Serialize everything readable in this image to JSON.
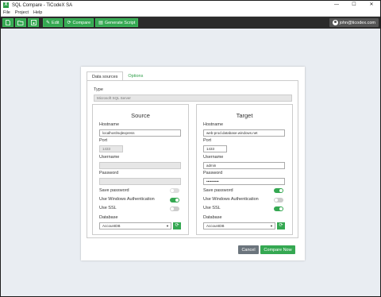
{
  "window": {
    "title": "SQL Compare - TiCodeX SA",
    "icon": "app-logo-icon",
    "controls": [
      "—",
      "☐",
      "✕"
    ]
  },
  "menu": {
    "items": [
      "File",
      "Project",
      "Help"
    ]
  },
  "toolbar": {
    "new_icon": "file-icon",
    "open_icon": "folder-open-icon",
    "save_icon": "save-icon",
    "edit_label": "Edit",
    "compare_label": "Compare",
    "generate_label": "Generate Script",
    "user_label": "john@ticodex.com"
  },
  "tabs": {
    "data_sources": "Data sources",
    "options": "Options"
  },
  "form": {
    "type_label": "Type",
    "type_value": "Microsoft SQL Server",
    "source": {
      "title": "Source",
      "hostname_label": "Hostname",
      "hostname_value": "localhost\\sqlexpress",
      "port_label": "Port",
      "port_value": "1433",
      "username_label": "Username",
      "username_value": "",
      "password_label": "Password",
      "password_value": "",
      "save_password_label": "Save password",
      "save_password_on": false,
      "windows_auth_label": "Use Windows Authentication",
      "windows_auth_on": true,
      "ssl_label": "Use SSL",
      "ssl_on": false,
      "database_label": "Database",
      "database_value": "AccountDB"
    },
    "target": {
      "title": "Target",
      "hostname_label": "Hostname",
      "hostname_value": "web-prod.database.windows.net",
      "port_label": "Port",
      "port_value": "1433",
      "username_label": "Username",
      "username_value": "admin",
      "password_label": "Password",
      "password_value": "••••••••••",
      "save_password_label": "Save password",
      "save_password_on": true,
      "windows_auth_label": "Use Windows Authentication",
      "windows_auth_on": false,
      "ssl_label": "Use SSL",
      "ssl_on": true,
      "database_label": "Database",
      "database_value": "AccountDB"
    }
  },
  "actions": {
    "cancel_label": "Cancel",
    "compare_now_label": "Compare Now"
  },
  "colors": {
    "accent": "#35a852",
    "toolbar_bg": "#2b2b2b",
    "background": "#e9edf2"
  }
}
